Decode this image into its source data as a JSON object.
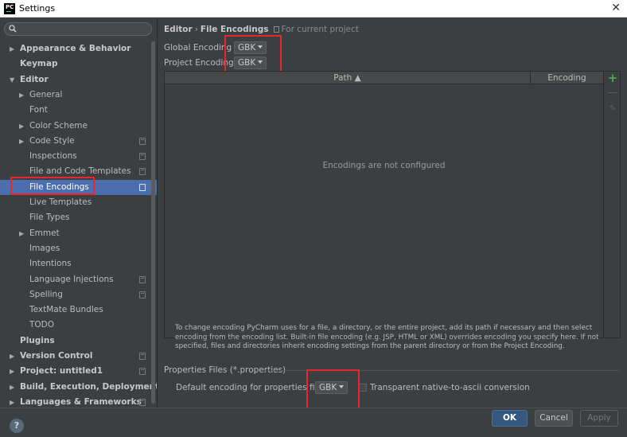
{
  "window": {
    "title": "Settings",
    "app_icon_text": "PC"
  },
  "search": {
    "placeholder": ""
  },
  "sidebar": {
    "items": [
      {
        "label": "Appearance & Behavior",
        "arrow": "▶",
        "bold": true
      },
      {
        "label": "Keymap",
        "arrow": "",
        "bold": true
      },
      {
        "label": "Editor",
        "arrow": "▼",
        "bold": true
      },
      {
        "label": "General",
        "arrow": "▶",
        "bold": false
      },
      {
        "label": "Font",
        "arrow": "",
        "bold": false
      },
      {
        "label": "Color Scheme",
        "arrow": "▶",
        "bold": false
      },
      {
        "label": "Code Style",
        "arrow": "▶",
        "bold": false,
        "project": true
      },
      {
        "label": "Inspections",
        "arrow": "",
        "bold": false,
        "project": true
      },
      {
        "label": "File and Code Templates",
        "arrow": "",
        "bold": false,
        "project": true
      },
      {
        "label": "File Encodings",
        "arrow": "",
        "bold": false,
        "project": true,
        "selected": true
      },
      {
        "label": "Live Templates",
        "arrow": "",
        "bold": false
      },
      {
        "label": "File Types",
        "arrow": "",
        "bold": false
      },
      {
        "label": "Emmet",
        "arrow": "▶",
        "bold": false
      },
      {
        "label": "Images",
        "arrow": "",
        "bold": false
      },
      {
        "label": "Intentions",
        "arrow": "",
        "bold": false
      },
      {
        "label": "Language Injections",
        "arrow": "",
        "bold": false,
        "project": true
      },
      {
        "label": "Spelling",
        "arrow": "",
        "bold": false,
        "project": true
      },
      {
        "label": "TextMate Bundles",
        "arrow": "",
        "bold": false
      },
      {
        "label": "TODO",
        "arrow": "",
        "bold": false
      },
      {
        "label": "Plugins",
        "arrow": "",
        "bold": true
      },
      {
        "label": "Version Control",
        "arrow": "▶",
        "bold": true,
        "project": true
      },
      {
        "label": "Project: untitled1",
        "arrow": "▶",
        "bold": true,
        "project": true
      },
      {
        "label": "Build, Execution, Deployment",
        "arrow": "▶",
        "bold": true
      },
      {
        "label": "Languages & Frameworks",
        "arrow": "▶",
        "bold": true,
        "project": true
      }
    ]
  },
  "breadcrumb": {
    "part1": "Editor",
    "separator": "›",
    "part2": "File Encodings",
    "scope": "For current project"
  },
  "global_encoding": {
    "label": "Global Encoding",
    "value": "GBK"
  },
  "project_encoding": {
    "label": "Project Encoding",
    "value": "GBK"
  },
  "table": {
    "col_path": "Path ▲",
    "col_encoding": "Encoding",
    "empty_message": "Encodings are not configured"
  },
  "tools": {
    "add": "+",
    "remove": "—",
    "edit": "✎"
  },
  "info_text": "To change encoding PyCharm uses for a file, a directory, or the entire project, add its path if necessary and then select encoding from the encoding list. Built-in file encoding (e.g. JSP, HTML or XML) overrides encoding you specify here. If not specified, files and directories inherit encoding settings from the parent directory or from the Project Encoding.",
  "properties": {
    "section_title": "Properties Files (*.properties)",
    "default_label": "Default encoding for properties files:",
    "default_value": "GBK",
    "transparent_label": "Transparent native-to-ascii conversion"
  },
  "buttons": {
    "ok": "OK",
    "cancel": "Cancel",
    "apply": "Apply",
    "help": "?"
  },
  "colors": {
    "selection": "#4b6eaf",
    "highlight_box": "#e8272a",
    "ok_button": "#365880",
    "add_icon": "#4fa84a"
  }
}
